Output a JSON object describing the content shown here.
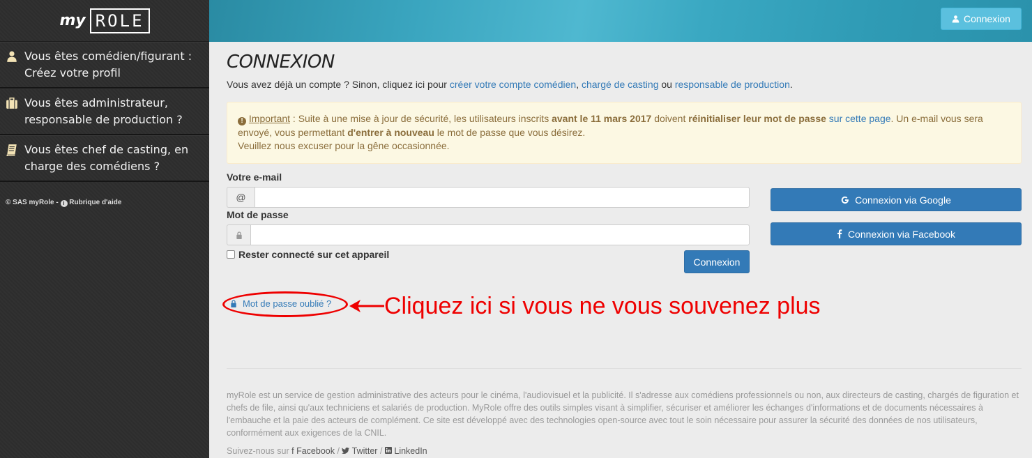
{
  "sidebar": {
    "logo_my": "my",
    "logo_role": "ROLE",
    "items": [
      {
        "icon": "user-icon",
        "line1": "Vous êtes comédien/figurant :",
        "line2": "Créez votre profil"
      },
      {
        "icon": "briefcase-icon",
        "line1": "Vous êtes administrateur,",
        "line2": "responsable de production ?"
      },
      {
        "icon": "book-icon",
        "line1": "Vous êtes chef de casting, en",
        "line2": "charge des comédiens ?"
      }
    ],
    "footer_copyright": "© SAS myRole -",
    "footer_help": "Rubrique d'aide"
  },
  "topbar": {
    "login_label": "Connexion"
  },
  "main": {
    "title": "CONNEXION",
    "intro_prefix": "Vous avez déjà un compte ? Sinon, cliquez ici pour ",
    "link_actor": "créer votre compte comédien",
    "sep1": ", ",
    "link_casting": "chargé de casting",
    "sep2": " ou ",
    "link_production": "responsable de production",
    "intro_suffix": ".",
    "alert": {
      "important": "Important",
      "t1": " : Suite à une mise à jour de sécurité, les utilisateurs inscrits ",
      "b1": "avant le 11 mars 2017",
      "t2": " doivent ",
      "b2": "réinitialiser leur mot de passe",
      "t3": " ",
      "link": "sur cette page",
      "t4": ". Un e-mail vous sera envoyé, vous permettant ",
      "b3": "d'entrer à nouveau",
      "t5": " le mot de passe que vous désirez.",
      "line3": "Veuillez nous excuser pour la gêne occasionnée."
    },
    "form": {
      "email_label": "Votre e-mail",
      "email_addon": "@",
      "email_value": "",
      "password_label": "Mot de passe",
      "password_value": "",
      "remember_label": "Rester connecté sur cet appareil",
      "submit_label": "Connexion"
    },
    "social": {
      "google_label": "Connexion via Google",
      "facebook_label": "Connexion via Facebook"
    },
    "forgot_label": "Mot de passe oublié ?",
    "annotation": "Cliquez ici si vous ne vous souvenez plus",
    "about": "myRole est un service de gestion administrative des acteurs pour le cinéma, l'audiovisuel et la publicité. Il s'adresse aux comédiens professionnels ou non, aux directeurs de casting, chargés de figuration et chefs de file, ainsi qu'aux techniciens et salariés de production. MyRole offre des outils simples visant à simplifier, sécuriser et améliorer les échanges d'informations et de documents nécessaires à l'embauche et la paie des acteurs de complément. Ce site est développé avec des technologies open-source avec tout le soin nécessaire pour assurer la sécurité des données de nos utilisateurs, conformément aux exigences de la CNIL.",
    "follow_prefix": "Suivez-nous sur",
    "follow_facebook": "Facebook",
    "follow_sep": " / ",
    "follow_twitter": "Twitter",
    "follow_linkedin": "LinkedIn"
  },
  "colors": {
    "primary": "#337ab7",
    "info": "#5bc0de",
    "annotation": "#ee0000",
    "sidebar_bg": "#2e2e2e"
  }
}
